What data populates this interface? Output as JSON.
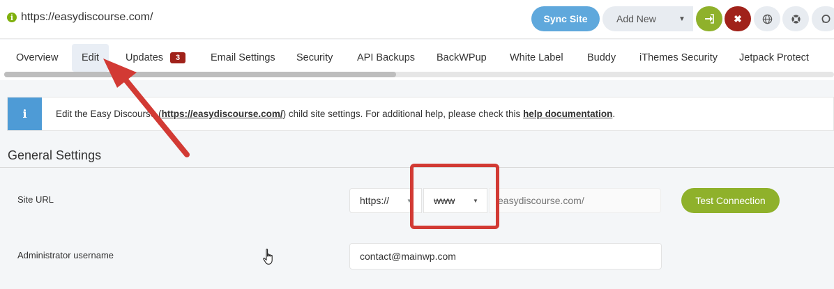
{
  "site": {
    "url": "https://easydiscourse.com/"
  },
  "toolbar": {
    "sync_label": "Sync Site",
    "add_new_label": "Add New"
  },
  "tabs": [
    {
      "label": "Overview"
    },
    {
      "label": "Edit"
    },
    {
      "label": "Updates",
      "badge": "3"
    },
    {
      "label": "Email Settings"
    },
    {
      "label": "Security"
    },
    {
      "label": "API Backups"
    },
    {
      "label": "BackWPup"
    },
    {
      "label": "White Label"
    },
    {
      "label": "Buddy"
    },
    {
      "label": "iThemes Security"
    },
    {
      "label": "Jetpack Protect"
    }
  ],
  "banner": {
    "prefix": "Edit the Easy Discourse (",
    "link": "https://easydiscourse.com/",
    "middle": ") child site settings. For additional help, please check this ",
    "help_link": "help documentation",
    "suffix": "."
  },
  "general": {
    "title": "General Settings",
    "site_url_label": "Site URL",
    "protocol_value": "https://",
    "www_value": "www",
    "domain_placeholder": "easydiscourse.com/",
    "test_label": "Test Connection",
    "admin_label": "Administrator username",
    "admin_value": "contact@mainwp.com"
  },
  "colors": {
    "accent_green": "#8fb12b",
    "sync_blue": "#5fa8dc",
    "danger_red": "#a0221a",
    "annotation_red": "#d23a34"
  }
}
